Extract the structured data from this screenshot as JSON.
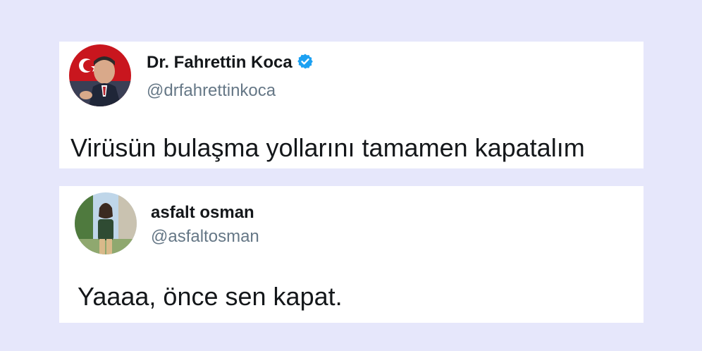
{
  "background_color": "#e6e7fb",
  "tweets": [
    {
      "author_name": "Dr. Fahrettin Koca",
      "handle": "@drfahrettinkoca",
      "verified": true,
      "verified_icon": "verified-badge-icon",
      "text": "Virüsün bulaşma yollarını tamamen kapatalım"
    },
    {
      "author_name": "asfalt osman",
      "handle": "@asfaltosman",
      "verified": false,
      "text": "Yaaaa, önce sen kapat."
    }
  ],
  "colors": {
    "verified_badge": "#1da1f2",
    "handle_text": "#657786",
    "body_text": "#14171a"
  }
}
